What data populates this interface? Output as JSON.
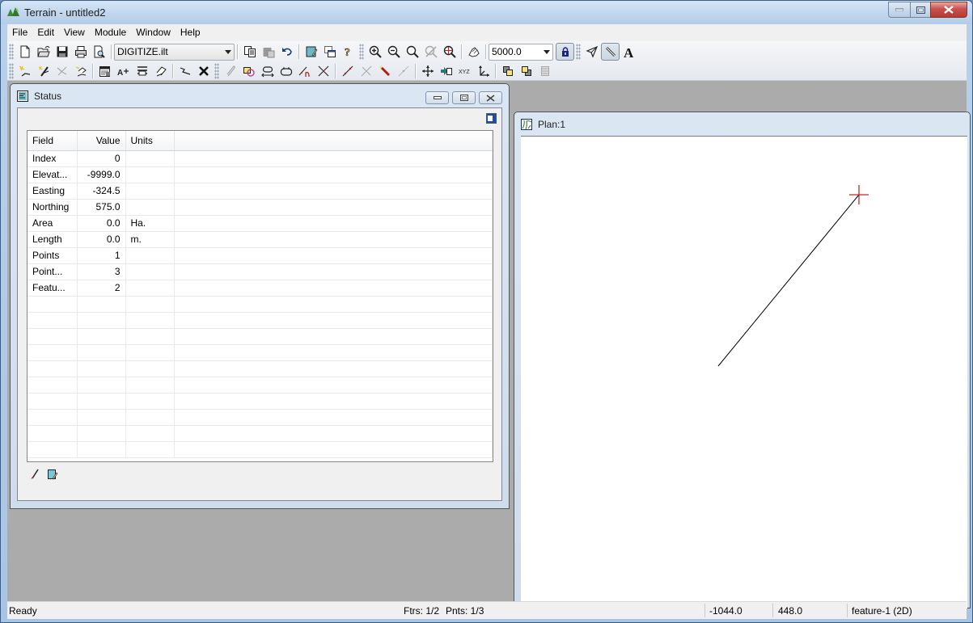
{
  "window": {
    "title": "Terrain - untitled2",
    "controls": [
      "minimize",
      "maximize",
      "close"
    ]
  },
  "menu": [
    "File",
    "Edit",
    "View",
    "Module",
    "Window",
    "Help"
  ],
  "toolbar": {
    "row1": {
      "file_buttons": [
        "new-icon",
        "open-icon",
        "save-icon",
        "print-icon",
        "print-preview-icon"
      ],
      "template_select": "DIGITIZE.ilt",
      "edit_buttons": [
        "copy-icon",
        "paste-icon",
        "undo-icon"
      ],
      "window_buttons": [
        "properties-icon",
        "cascade-window-icon",
        "help-icon"
      ],
      "zoom_buttons": [
        "zoom-in-icon",
        "zoom-out-icon",
        "zoom-window-icon",
        "zoom-previous-icon",
        "zoom-extents-icon"
      ],
      "pan_button": "pan-hand-icon",
      "scale_select": "5000.0",
      "lock_button": "scale-lock-icon",
      "mode_buttons": [
        "select-pointer-icon",
        "digitize-pencil-icon",
        "text-icon"
      ]
    },
    "row2": {
      "feature_buttons": [
        "new-feature-icon",
        "edit-feature-icon",
        "delete-feature-icon",
        "feature-properties-icon"
      ],
      "attribute_buttons": [
        "attribute-table-icon",
        "label-icon",
        "layers-icon",
        "feature-edit-icon"
      ],
      "line_buttons": [
        "join-lines-icon",
        "delete-icon"
      ],
      "edit_tools": [
        "attach-icon",
        "select-area-icon",
        "swap-icon",
        "close-polygon-icon",
        "insert-point-icon",
        "intersect-icon"
      ],
      "point_tools": [
        "add-point-icon",
        "remove-point-icon",
        "marker-icon",
        "move-point-icon"
      ],
      "transform_tools": [
        "move-icon",
        "import-icon",
        "xyz-icon",
        "axes-icon"
      ],
      "order_tools": [
        "bring-forward-icon",
        "send-backward-icon",
        "hatch-icon"
      ],
      "xyz_label": "XYZ"
    }
  },
  "status_window": {
    "title": "Status",
    "columns": [
      "Field",
      "Value",
      "Units"
    ],
    "rows": [
      {
        "field": "Index",
        "value": "0",
        "units": ""
      },
      {
        "field": "Elevat...",
        "value": "-9999.0",
        "units": ""
      },
      {
        "field": "Easting",
        "value": "-324.5",
        "units": ""
      },
      {
        "field": "Northing",
        "value": "575.0",
        "units": ""
      },
      {
        "field": "Area",
        "value": "0.0",
        "units": "Ha."
      },
      {
        "field": "Length",
        "value": "0.0",
        "units": "m."
      },
      {
        "field": "Points",
        "value": "1",
        "units": ""
      },
      {
        "field": "Point...",
        "value": "3",
        "units": ""
      },
      {
        "field": "Featu...",
        "value": "2",
        "units": ""
      }
    ],
    "empty_rows": 10,
    "bottom_icons": [
      "brush-icon",
      "edit-record-icon"
    ]
  },
  "plan_window": {
    "title": "Plan:1",
    "line_color": "#000000",
    "cursor_color": "#c0282d"
  },
  "statusbar": {
    "message": "Ready",
    "features": "Ftrs: 1/2",
    "points": "Pnts: 1/3",
    "x": "-1044.0",
    "y": "448.0",
    "feature": "feature-1 (2D)"
  }
}
